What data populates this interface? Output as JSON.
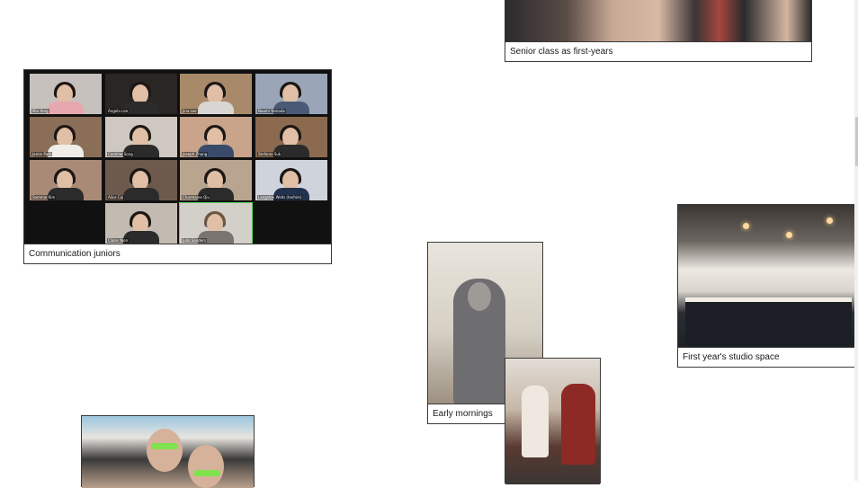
{
  "cards": {
    "senior": {
      "caption": "Senior class as first-years"
    },
    "comm": {
      "caption": "Communication juniors",
      "tiles": [
        "Mia Yang",
        "Angela Lee",
        "Jina Lee",
        "Naomi Yamada",
        "Jamie Park",
        "Caroline Song",
        "Joseph Zhang",
        "Stefanie Suk",
        "Sammie Kim",
        "Alice Cai",
        "Charmaine Qiu",
        "Langston Wells (he/him)",
        "Claire Yoon",
        "Julia Sanders"
      ]
    },
    "early": {
      "caption": "Early mornings"
    },
    "studio": {
      "caption": "First year's studio space"
    }
  },
  "colors": {
    "border": "#3a3a3a",
    "background": "#ffffff",
    "caption_text": "#1a1a1a"
  }
}
